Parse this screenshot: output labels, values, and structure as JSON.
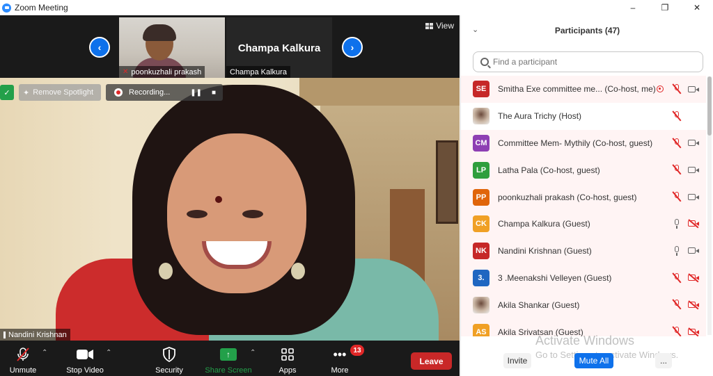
{
  "window": {
    "title": "Zoom Meeting",
    "minimize": "–",
    "maximize": "❐",
    "close": "✕"
  },
  "strip": {
    "thumb1_name": "poonkuzhali prakash",
    "thumb2_big_name": "Champa Kalkura",
    "thumb2_name": "Champa Kalkura",
    "view_label": "View"
  },
  "main": {
    "spotlight_label": "Remove Spotlight",
    "recording_label": "Recording...",
    "speaker_name": "Nandini Krishnan"
  },
  "toolbar": {
    "unmute": "Unmute",
    "stop_video": "Stop Video",
    "security": "Security",
    "share_screen": "Share Screen",
    "apps": "Apps",
    "more": "More",
    "more_badge": "13",
    "leave": "Leave"
  },
  "panel": {
    "title": "Participants (47)",
    "search_placeholder": "Find a participant",
    "participants": [
      {
        "initials": "SE",
        "color": "#c62828",
        "name": "Smitha Exe committee me...",
        "role": "(Co-host, me)",
        "recording": true,
        "mic": "off",
        "cam": "on"
      },
      {
        "initials": "",
        "color": "#ffffff",
        "name": "The Aura Trichy",
        "role": "(Host)",
        "photo": true,
        "mic": "off",
        "cam": "none"
      },
      {
        "initials": "CM",
        "color": "#8e3fb3",
        "name": "Committee Mem- Mythily",
        "role": "(Co-host, guest)",
        "mic": "off",
        "cam": "on"
      },
      {
        "initials": "LP",
        "color": "#2e9e3d",
        "name": "Latha Pala",
        "role": "(Co-host, guest)",
        "mic": "off",
        "cam": "on"
      },
      {
        "initials": "PP",
        "color": "#e0650a",
        "name": "poonkuzhali prakash",
        "role": "(Co-host, guest)",
        "mic": "off",
        "cam": "on"
      },
      {
        "initials": "CK",
        "color": "#f0a025",
        "name": "Champa Kalkura",
        "role": "(Guest)",
        "mic": "on",
        "cam": "off"
      },
      {
        "initials": "NK",
        "color": "#c62828",
        "name": "Nandini Krishnan",
        "role": "(Guest)",
        "mic": "on",
        "cam": "on"
      },
      {
        "initials": "3.",
        "color": "#1f66c1",
        "name": "3 .Meenakshi Velleyen",
        "role": "(Guest)",
        "mic": "off",
        "cam": "off"
      },
      {
        "initials": "",
        "color": "#ffffff",
        "name": "Akila Shankar",
        "role": "(Guest)",
        "photo": true,
        "mic": "off",
        "cam": "off"
      },
      {
        "initials": "AS",
        "color": "#f0a025",
        "name": "Akila Srivatsan",
        "role": "(Guest)",
        "mic": "off",
        "cam": "off"
      }
    ],
    "invite": "Invite",
    "mute_all": "Mute All",
    "more": "...",
    "watermark_title": "Activate Windows",
    "watermark_sub": "Go to Settings to activate Windows."
  }
}
